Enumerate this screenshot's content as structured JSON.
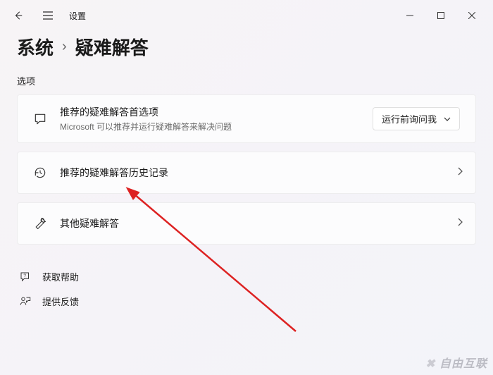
{
  "app_title": "设置",
  "breadcrumb": {
    "parent": "系统",
    "current": "疑难解答"
  },
  "section_label": "选项",
  "cards": {
    "preferences": {
      "title": "推荐的疑难解答首选项",
      "subtitle": "Microsoft 可以推荐并运行疑难解答来解决问题",
      "dropdown_value": "运行前询问我"
    },
    "history": {
      "title": "推荐的疑难解答历史记录"
    },
    "other": {
      "title": "其他疑难解答"
    }
  },
  "footer": {
    "help": "获取帮助",
    "feedback": "提供反馈"
  },
  "watermark": "自由互联"
}
